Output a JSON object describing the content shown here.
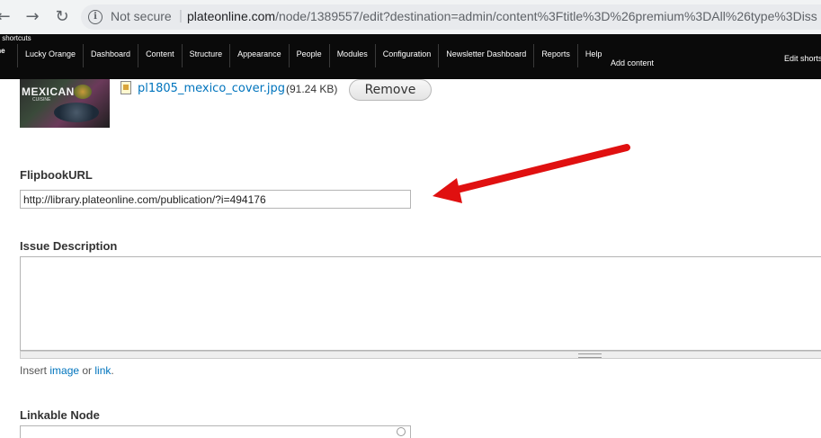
{
  "browser": {
    "security_label": "Not secure",
    "url_host": "plateonline.com",
    "url_path": "/node/1389557/edit?destination=admin/content%3Ftitle%3D%26premium%3DAll%26type%3Diss"
  },
  "admin_toolbar": {
    "shortcuts_label": "v shortcuts",
    "home_label": "me",
    "menu": [
      "Lucky Orange",
      "Dashboard",
      "Content",
      "Structure",
      "Appearance",
      "People",
      "Modules",
      "Configuration",
      "Newsletter Dashboard",
      "Reports",
      "Help"
    ],
    "add_content": "Add content",
    "edit_shortcuts": "Edit shorts"
  },
  "image_field": {
    "thumbnail_title": "MEXICAN",
    "thumbnail_subtitle": "CUISINE",
    "file_name": "pl1805_mexico_cover.jpg",
    "file_size": "(91.24 KB)",
    "remove_label": "Remove"
  },
  "flipbook": {
    "label": "FlipbookURL",
    "value": "http://library.plateonline.com/publication/?i=494176"
  },
  "issue_description": {
    "label": "Issue Description",
    "value": "",
    "insert_prefix": "Insert ",
    "image_link": "image",
    "or_text": " or ",
    "link_link": "link",
    "suffix": "."
  },
  "linkable_node": {
    "label": "Linkable Node",
    "value": ""
  },
  "colors": {
    "link": "#0074bd",
    "toolbar_bg": "#0a0a0a",
    "annotation_arrow": "#e01010"
  }
}
